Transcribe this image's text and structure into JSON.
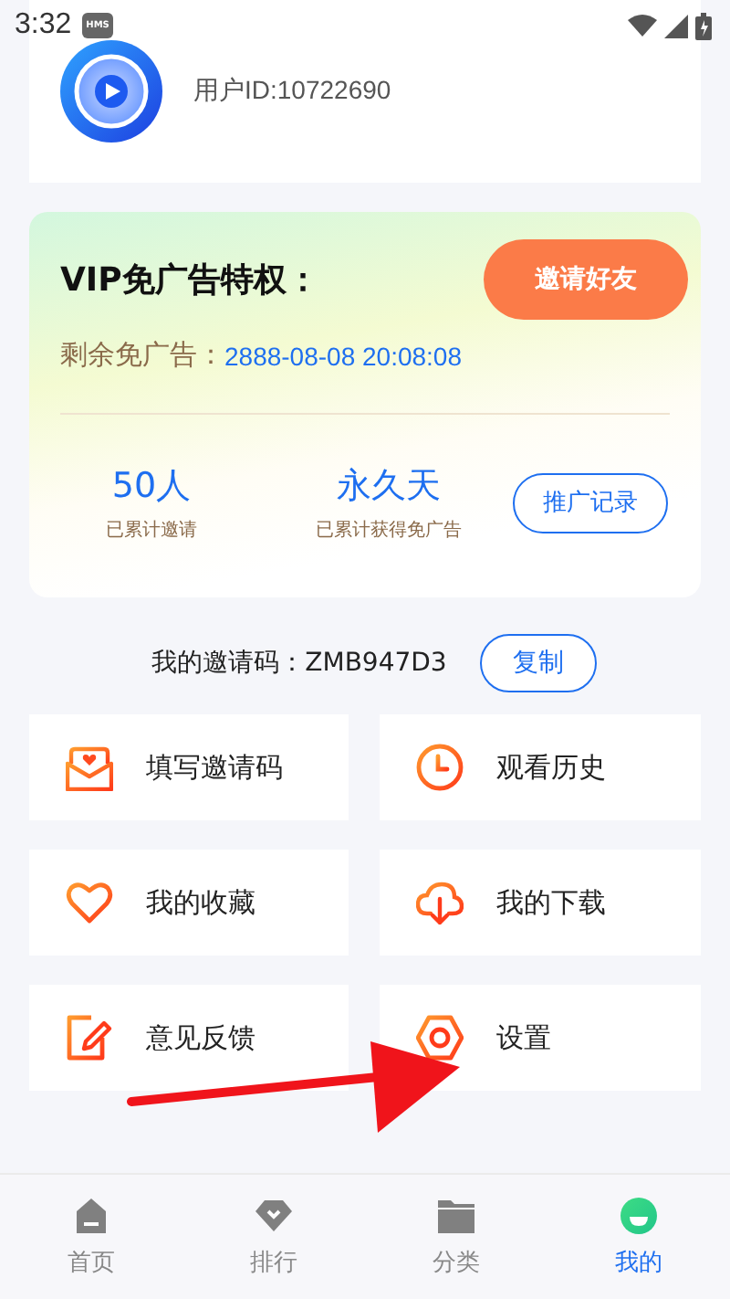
{
  "status_bar": {
    "time": "3:32",
    "badge": "HMS"
  },
  "profile": {
    "user_id": "用户ID:10722690"
  },
  "vip": {
    "title": "VIP免广告特权：",
    "invite_button": "邀请好友",
    "remaining_label": "剩余免广告：",
    "remaining_value": "2888-08-08 20:08:08",
    "stats": [
      {
        "value": "50人",
        "label": "已累计邀请"
      },
      {
        "value": "永久天",
        "label": "已累计获得免广告"
      }
    ],
    "record_button": "推广记录"
  },
  "invite_code": {
    "text": "我的邀请码：ZMB947D3",
    "copy_button": "复制"
  },
  "menu": [
    {
      "kind": "envelope",
      "label": "填写邀请码"
    },
    {
      "kind": "clock",
      "label": "观看历史"
    },
    {
      "kind": "heart",
      "label": "我的收藏"
    },
    {
      "kind": "download",
      "label": "我的下载"
    },
    {
      "kind": "edit",
      "label": "意见反馈"
    },
    {
      "kind": "settings",
      "label": "设置"
    }
  ],
  "tabs": [
    {
      "kind": "home",
      "label": "首页",
      "selected": false
    },
    {
      "kind": "rank",
      "label": "排行",
      "selected": false
    },
    {
      "kind": "folder",
      "label": "分类",
      "selected": false
    },
    {
      "kind": "me",
      "label": "我的",
      "selected": true
    }
  ]
}
